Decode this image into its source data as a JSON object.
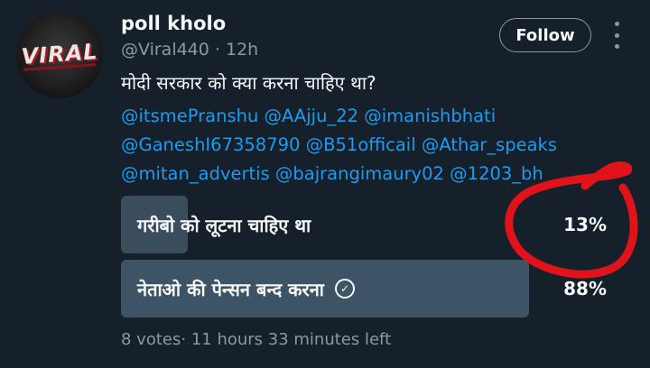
{
  "author": {
    "display_name": "poll kholo",
    "handle": "@Viral440",
    "separator": " · ",
    "time": "12h",
    "avatar_text": "VIRAL"
  },
  "actions": {
    "follow_label": "Follow",
    "more_icon": "more-vertical-icon"
  },
  "tweet": {
    "text": "मोदी सरकार को क्या करना चाहिए था?",
    "mention_lines": [
      "@itsmePranshu @AAjju_22 @imanishbhati",
      "@GaneshI67358790 @B51officail @Athar_speaks",
      "@mitan_advertis @bajrangimaury02 @1203_bh"
    ]
  },
  "poll": {
    "options": [
      {
        "label": "गरीबो को लूटना चाहिए था",
        "percent_text": "13%",
        "percent": 13,
        "selected": false
      },
      {
        "label": "नेताओ की पेन्सन बन्द करना",
        "percent_text": "88%",
        "percent": 88,
        "selected": true
      }
    ],
    "votes": "8 votes",
    "separator": "·",
    "time_left": " 11 hours 33 minutes left",
    "selected_icon": "check-circle-icon"
  },
  "colors": {
    "background": "#15202b",
    "mention": "#1d9bf0",
    "muted": "#8b98a5",
    "poll_bar": "#3d5466",
    "annotation": "#e0131a"
  }
}
